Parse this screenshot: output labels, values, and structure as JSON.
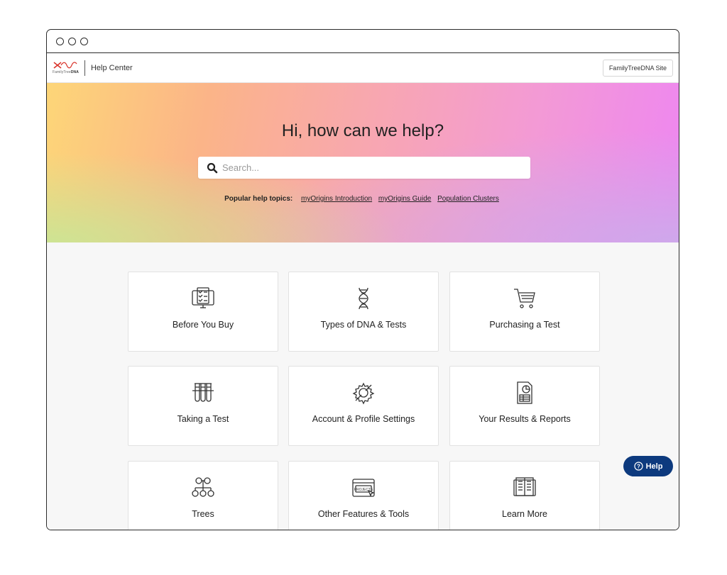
{
  "header": {
    "logo_small": "FamilyTree",
    "logo_bold": "DNA",
    "section": "Help Center",
    "site_button": "FamilyTreeDNA Site"
  },
  "hero": {
    "title": "Hi, how can we help?",
    "search_placeholder": "Search...",
    "popular_label": "Popular help topics:",
    "popular_links": [
      "myOrigins Introduction",
      "myOrigins Guide",
      "Population Clusters"
    ]
  },
  "cards": [
    {
      "label": "Before You Buy",
      "icon": "checklist-monitor-icon"
    },
    {
      "label": "Types of DNA & Tests",
      "icon": "dna-helix-icon"
    },
    {
      "label": "Purchasing a Test",
      "icon": "shopping-cart-icon"
    },
    {
      "label": "Taking a Test",
      "icon": "test-tubes-icon"
    },
    {
      "label": "Account & Profile Settings",
      "icon": "gear-wrench-icon"
    },
    {
      "label": "Your Results & Reports",
      "icon": "report-icon"
    },
    {
      "label": "Trees",
      "icon": "family-tree-icon"
    },
    {
      "label": "Other Features & Tools",
      "icon": "projects-screen-icon"
    },
    {
      "label": "Learn More",
      "icon": "open-book-icon"
    }
  ],
  "help_button": {
    "label": "Help",
    "icon": "question-circle-icon"
  },
  "colors": {
    "accent": "#0d3a7e",
    "logo_red": "#d9342b"
  }
}
